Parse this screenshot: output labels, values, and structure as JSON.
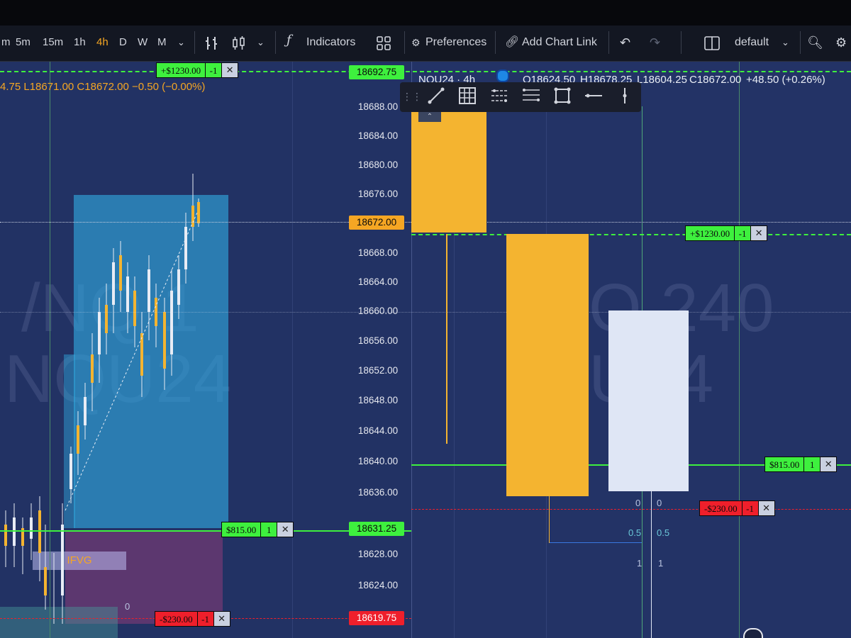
{
  "toolbar": {
    "timeframes": [
      "m",
      "5m",
      "15m",
      "1h",
      "4h",
      "D",
      "W",
      "M"
    ],
    "active_timeframe": "4h",
    "indicators_label": "Indicators",
    "preferences_label": "Preferences",
    "add_chart_link_label": "Add Chart Link",
    "layout_label": "default"
  },
  "left_chart": {
    "ohlc_partial": "4.75 L18671.00 C18672.00 −0.50 (−0.00%)",
    "watermark_line1": "/NQ 1",
    "watermark_line2": "NQU24",
    "ifvg_label": "IFVG",
    "zero_label": "0"
  },
  "right_chart": {
    "symbol": "NQU24 · 4h",
    "open": "O18624.50",
    "high": "H18678.25",
    "low": "L18604.25",
    "close": "C18672.00",
    "change": "+48.50 (+0.26%)",
    "watermark_line1": "Q 240",
    "watermark_line2": "U24",
    "fib_labels": {
      "a0": "0",
      "b0": "0",
      "a05": "0.5",
      "b05": "0.5",
      "a1": "1",
      "b1": "1"
    }
  },
  "price_axis": {
    "ticks": [
      "18688.00",
      "18684.00",
      "18680.00",
      "18676.00",
      "18668.00",
      "18664.00",
      "18660.00",
      "18656.00",
      "18652.00",
      "18648.00",
      "18644.00",
      "18640.00",
      "18636.00",
      "18628.00",
      "18624.00"
    ],
    "top_tag": "18692.75",
    "current_tag": "18672.00",
    "mid_tag": "18631.25",
    "bottom_tag": "18619.75"
  },
  "orders": {
    "profit_target": {
      "value": "+$1230.00",
      "qty": "-1",
      "close": "✕"
    },
    "entry": {
      "value": "$815.00",
      "qty": "1",
      "close": "✕"
    },
    "stop_loss": {
      "value": "-$230.00",
      "qty": "-1",
      "close": "✕"
    }
  },
  "colors": {
    "background": "#223264",
    "up_candle": "#f4b430",
    "down_candle": "#dfe6f5",
    "target_green": "#3ef03e",
    "stop_red": "#ef1f2b",
    "accent_orange": "#f5a623"
  }
}
